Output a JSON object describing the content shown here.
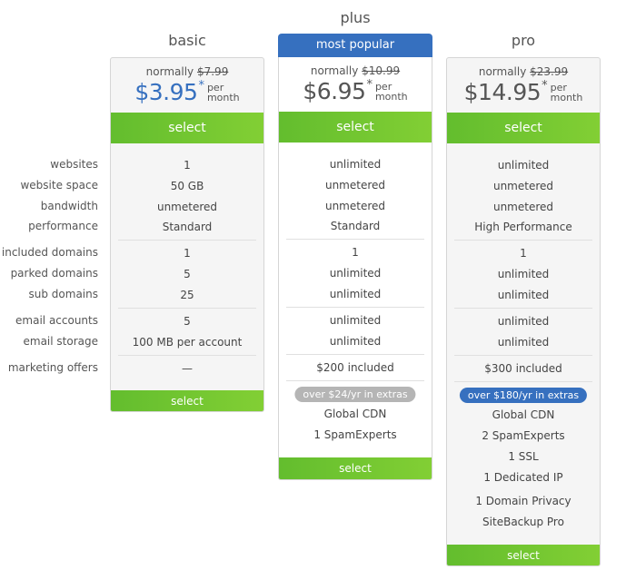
{
  "row_labels": [
    "websites",
    "website space",
    "bandwidth",
    "performance",
    "included domains",
    "parked domains",
    "sub domains",
    "email accounts",
    "email storage",
    "marketing offers"
  ],
  "plans": [
    {
      "name": "basic",
      "badge": null,
      "normally_label": "normally",
      "original_price": "$7.99",
      "price": "$3.95",
      "asterisk": "*",
      "per": "per",
      "month": "month",
      "select_label": "select",
      "values": [
        "1",
        "50 GB",
        "unmetered",
        "Standard",
        "1",
        "5",
        "25",
        "5",
        "100 MB per account",
        "—"
      ],
      "extras_badge": null,
      "extras": []
    },
    {
      "name": "plus",
      "badge": "most popular",
      "normally_label": "normally",
      "original_price": "$10.99",
      "price": "$6.95",
      "asterisk": "*",
      "per": "per",
      "month": "month",
      "select_label": "select",
      "values": [
        "unlimited",
        "unmetered",
        "unmetered",
        "Standard",
        "1",
        "unlimited",
        "unlimited",
        "unlimited",
        "unlimited",
        "$200 included"
      ],
      "extras_badge": "over $24/yr in extras",
      "extras": [
        "Global CDN",
        "1 SpamExperts"
      ]
    },
    {
      "name": "pro",
      "badge": null,
      "normally_label": "normally",
      "original_price": "$23.99",
      "price": "$14.95",
      "asterisk": "*",
      "per": "per",
      "month": "month",
      "select_label": "select",
      "values": [
        "unlimited",
        "unmetered",
        "unmetered",
        "High Performance",
        "1",
        "unlimited",
        "unlimited",
        "unlimited",
        "unlimited",
        "$300 included"
      ],
      "extras_badge": "over $180/yr in extras",
      "extras": [
        "Global CDN",
        "2 SpamExperts",
        "1 SSL",
        "1 Dedicated IP",
        "1 Domain Privacy",
        "SiteBackup Pro"
      ]
    }
  ],
  "colors": {
    "accent_blue": "#3670bf",
    "select_green": "#6cc331",
    "extras_gray": "#b5b5b5"
  }
}
